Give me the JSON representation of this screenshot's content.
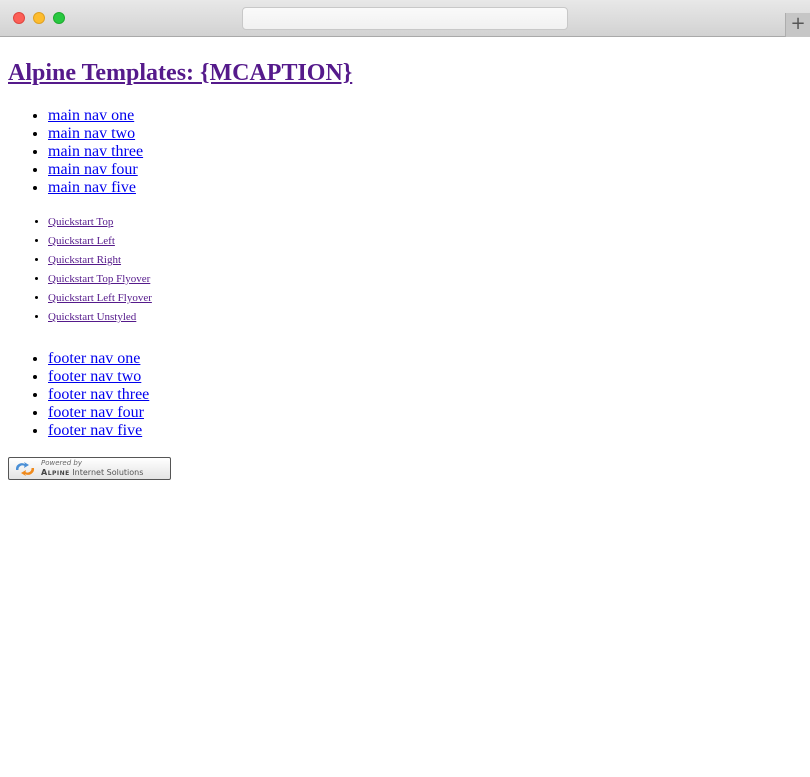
{
  "browser": {
    "url": "",
    "new_tab_symbol": "+"
  },
  "page": {
    "title": "Alpine Templates: {MCAPTION}",
    "main_nav": [
      "main nav one",
      "main nav two",
      "main nav three",
      "main nav four",
      "main nav five"
    ],
    "quickstart_nav": [
      "Quickstart Top",
      "Quickstart Left",
      "Quickstart Right",
      "Quickstart Top Flyover",
      "Quickstart Left Flyover",
      "Quickstart Unstyled"
    ],
    "footer_nav": [
      "footer nav one",
      "footer nav two",
      "footer nav three",
      "footer nav four",
      "footer nav five"
    ],
    "badge": {
      "powered_by": "Powered by",
      "brand": "Alpine",
      "company_suffix": "Internet Solutions"
    }
  },
  "colors": {
    "link": "#0000ee",
    "visited_link": "#551a8b"
  }
}
